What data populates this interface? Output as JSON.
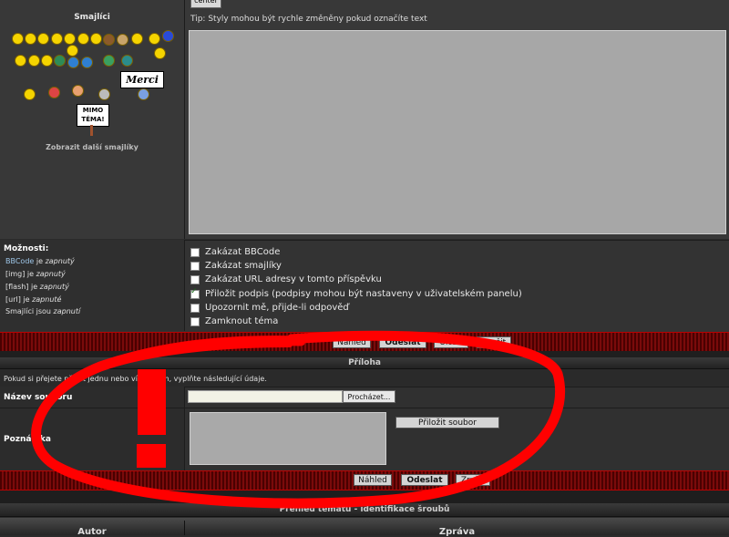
{
  "smileys": {
    "title": "Smajlíci",
    "more_link": "Zobrazit další smajlíky",
    "merci_sign": "Merci",
    "mimo_sign_line1": "MIMO",
    "mimo_sign_line2": "TÉMA!"
  },
  "editor": {
    "center_button": "center",
    "tip": "Tip: Styly mohou být rychle změněny pokud označíte text"
  },
  "options": {
    "title": "Možnosti:",
    "status": [
      {
        "name": "BBCode",
        "suffix": " je ",
        "state": "zapnutý"
      },
      {
        "name": "[img]",
        "suffix": " je ",
        "state": "zapnutý"
      },
      {
        "name": "[flash]",
        "suffix": " je ",
        "state": "zapnutý"
      },
      {
        "name": "[url]",
        "suffix": " je ",
        "state": "zapnuté"
      },
      {
        "name": "Smajlíci",
        "suffix": " jsou ",
        "state": "zapnutí"
      }
    ],
    "checkboxes": [
      {
        "label": "Zakázat BBCode",
        "checked": false
      },
      {
        "label": "Zakázat smajlíky",
        "checked": false
      },
      {
        "label": "Zakázat URL adresy v tomto příspěvku",
        "checked": false
      },
      {
        "label": "Přiložit podpis (podpisy mohou být nastaveny v uživatelském panelu)",
        "checked": true
      },
      {
        "label": "Upozornit mě, přijde-li odpověď",
        "checked": false
      },
      {
        "label": "Zamknout téma",
        "checked": false
      }
    ]
  },
  "buttons": {
    "preview": "Náhled",
    "submit": "Odeslat",
    "save": "Uložit",
    "cancel": "Zrušit"
  },
  "attachment": {
    "header": "Příloha",
    "info": "Pokud si přejete přidat jednu nebo více příloh, vyplňte následující údaje.",
    "file_label": "Název souboru",
    "browse_button": "Procházet...",
    "note_label": "Poznámka",
    "attach_button": "Přiložit soubor"
  },
  "topic_review": {
    "header": "Přehled tématu - identifikace šroubů",
    "col_author": "Autor",
    "col_message": "Zpráva"
  },
  "colors": {
    "annotation": "#ff0000",
    "textarea": "#a7a7a7",
    "bar": "#7a0b0b"
  }
}
